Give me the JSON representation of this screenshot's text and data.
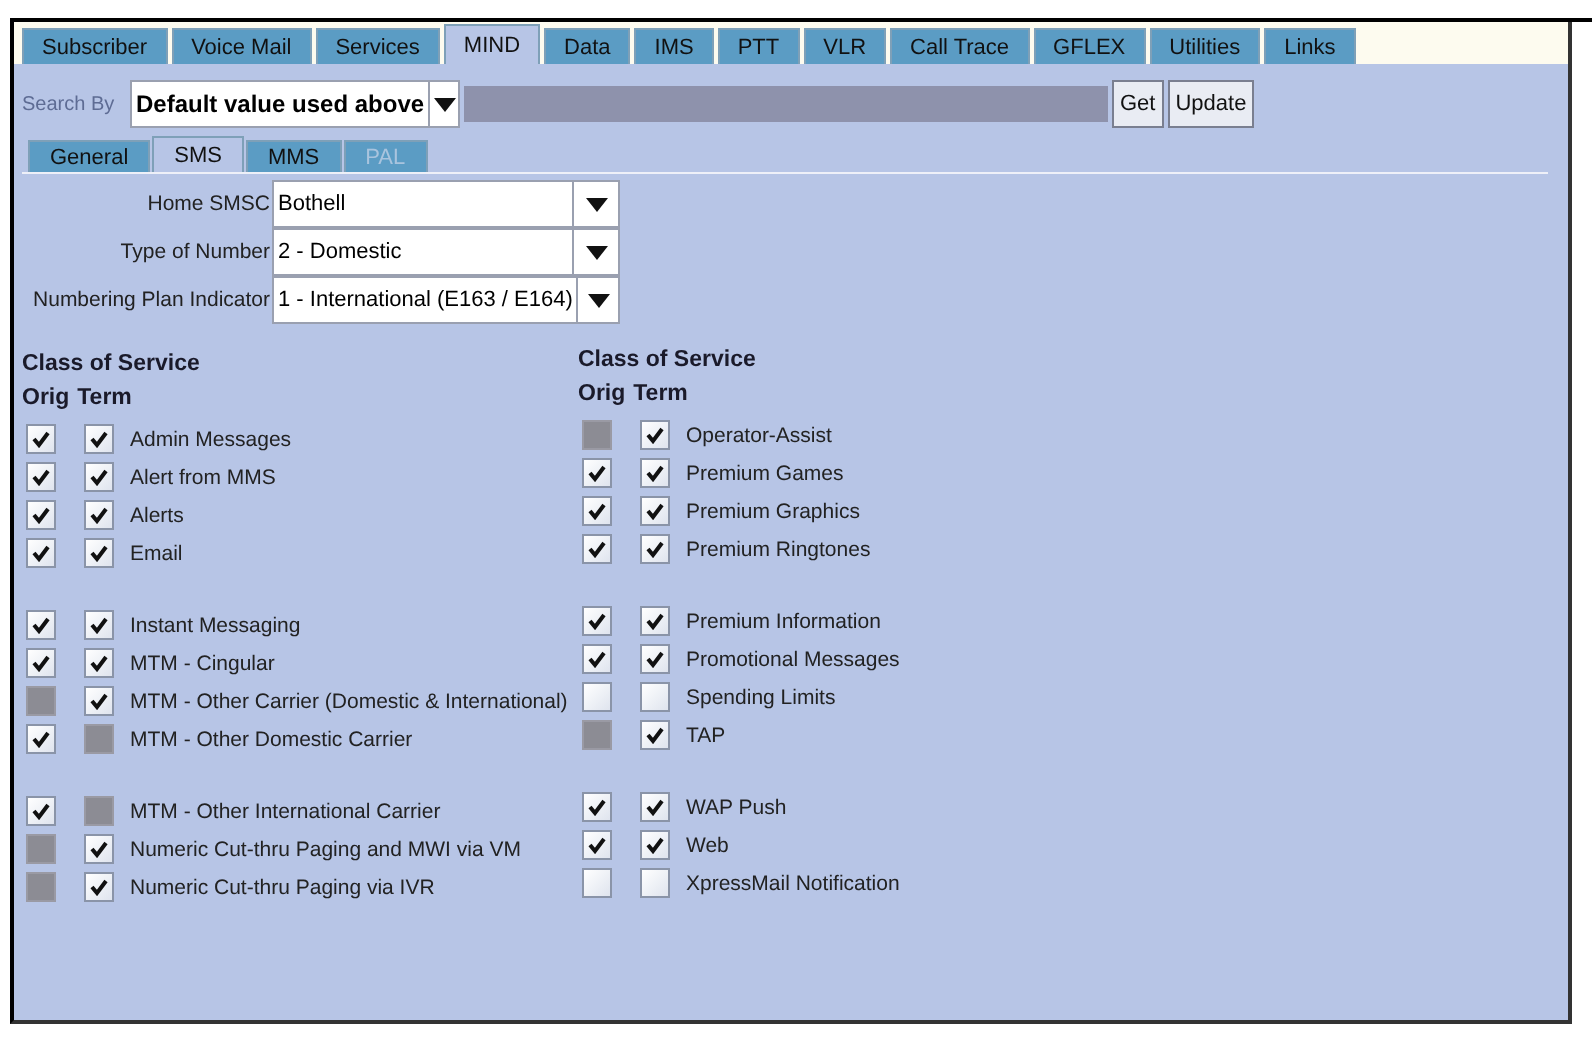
{
  "tabs": [
    {
      "label": "Subscriber",
      "selected": false
    },
    {
      "label": "Voice Mail",
      "selected": false
    },
    {
      "label": "Services",
      "selected": false
    },
    {
      "label": "MIND",
      "selected": true
    },
    {
      "label": "Data",
      "selected": false
    },
    {
      "label": "IMS",
      "selected": false
    },
    {
      "label": "PTT",
      "selected": false
    },
    {
      "label": "VLR",
      "selected": false
    },
    {
      "label": "Call Trace",
      "selected": false
    },
    {
      "label": "GFLEX",
      "selected": false
    },
    {
      "label": "Utilities",
      "selected": false
    },
    {
      "label": "Links",
      "selected": false
    }
  ],
  "search": {
    "label": "Search By",
    "value": "Default value used above",
    "input": {
      "disabled": true
    },
    "buttons": [
      "Get",
      "Update"
    ]
  },
  "subtabs": [
    {
      "label": "General",
      "selected": false,
      "disabled": false
    },
    {
      "label": "SMS",
      "selected": true,
      "disabled": false
    },
    {
      "label": "MMS",
      "selected": false,
      "disabled": false
    },
    {
      "label": "PAL",
      "selected": false,
      "disabled": true
    }
  ],
  "fields": [
    {
      "label": "Home SMSC",
      "value": "Bothell"
    },
    {
      "label": "Type of Number",
      "value": "2 - Domestic"
    },
    {
      "label": "Numbering Plan Indicator",
      "value": "1 - International (E163 / E164)"
    }
  ],
  "class_of_service": [
    {
      "title": "Class of Service",
      "orig_header": "Orig",
      "term_header": "Term",
      "groups": [
        [
          {
            "label": "Admin Messages",
            "orig": {
              "checked": true,
              "disabled": false
            },
            "term": {
              "checked": true,
              "disabled": false
            }
          },
          {
            "label": "Alert from MMS",
            "orig": {
              "checked": true,
              "disabled": false
            },
            "term": {
              "checked": true,
              "disabled": false
            }
          },
          {
            "label": "Alerts",
            "orig": {
              "checked": true,
              "disabled": false
            },
            "term": {
              "checked": true,
              "disabled": false
            }
          },
          {
            "label": "Email",
            "orig": {
              "checked": true,
              "disabled": false
            },
            "term": {
              "checked": true,
              "disabled": false
            }
          }
        ],
        [
          {
            "label": "Instant Messaging",
            "orig": {
              "checked": true,
              "disabled": false
            },
            "term": {
              "checked": true,
              "disabled": false
            }
          },
          {
            "label": "MTM - Cingular",
            "orig": {
              "checked": true,
              "disabled": false
            },
            "term": {
              "checked": true,
              "disabled": false
            }
          },
          {
            "label": "MTM - Other Carrier (Domestic & International)",
            "orig": {
              "checked": false,
              "disabled": true
            },
            "term": {
              "checked": true,
              "disabled": false
            }
          },
          {
            "label": "MTM - Other Domestic Carrier",
            "orig": {
              "checked": true,
              "disabled": false
            },
            "term": {
              "checked": false,
              "disabled": true
            }
          }
        ],
        [
          {
            "label": "MTM - Other International Carrier",
            "orig": {
              "checked": true,
              "disabled": false
            },
            "term": {
              "checked": false,
              "disabled": true
            }
          },
          {
            "label": "Numeric Cut-thru Paging and MWI via VM",
            "orig": {
              "checked": false,
              "disabled": true
            },
            "term": {
              "checked": true,
              "disabled": false
            }
          },
          {
            "label": "Numeric Cut-thru Paging via IVR",
            "orig": {
              "checked": false,
              "disabled": true
            },
            "term": {
              "checked": true,
              "disabled": false
            }
          }
        ]
      ]
    },
    {
      "title": "Class of Service",
      "orig_header": "Orig",
      "term_header": "Term",
      "groups": [
        [
          {
            "label": "Operator-Assist",
            "orig": {
              "checked": false,
              "disabled": true
            },
            "term": {
              "checked": true,
              "disabled": false
            }
          },
          {
            "label": "Premium Games",
            "orig": {
              "checked": true,
              "disabled": false
            },
            "term": {
              "checked": true,
              "disabled": false
            }
          },
          {
            "label": "Premium Graphics",
            "orig": {
              "checked": true,
              "disabled": false
            },
            "term": {
              "checked": true,
              "disabled": false
            }
          },
          {
            "label": "Premium Ringtones",
            "orig": {
              "checked": true,
              "disabled": false
            },
            "term": {
              "checked": true,
              "disabled": false
            }
          }
        ],
        [
          {
            "label": "Premium Information",
            "orig": {
              "checked": true,
              "disabled": false
            },
            "term": {
              "checked": true,
              "disabled": false
            }
          },
          {
            "label": "Promotional Messages",
            "orig": {
              "checked": true,
              "disabled": false
            },
            "term": {
              "checked": true,
              "disabled": false
            }
          },
          {
            "label": "Spending Limits",
            "orig": {
              "checked": false,
              "disabled": false
            },
            "term": {
              "checked": false,
              "disabled": false
            }
          },
          {
            "label": "TAP",
            "orig": {
              "checked": false,
              "disabled": true
            },
            "term": {
              "checked": true,
              "disabled": false
            }
          }
        ],
        [
          {
            "label": "WAP Push",
            "orig": {
              "checked": true,
              "disabled": false
            },
            "term": {
              "checked": true,
              "disabled": false
            }
          },
          {
            "label": "Web",
            "orig": {
              "checked": true,
              "disabled": false
            },
            "term": {
              "checked": true,
              "disabled": false
            }
          },
          {
            "label": "XpressMail Notification",
            "orig": {
              "checked": false,
              "disabled": false
            },
            "term": {
              "checked": false,
              "disabled": false
            }
          }
        ]
      ]
    }
  ]
}
